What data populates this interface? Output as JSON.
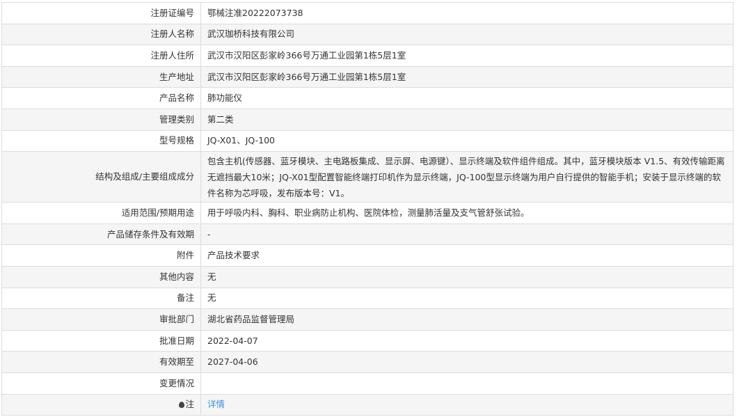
{
  "rows": [
    {
      "label": "注册证编号",
      "value": "鄂械注准20222073738"
    },
    {
      "label": "注册人名称",
      "value": "武汉珈桥科技有限公司"
    },
    {
      "label": "注册人住所",
      "value": "武汉市汉阳区彭家岭366号万通工业园第1栋5层1室"
    },
    {
      "label": "生产地址",
      "value": "武汉市汉阳区彭家岭366号万通工业园第1栋5层1室"
    },
    {
      "label": "产品名称",
      "value": "肺功能仪"
    },
    {
      "label": "管理类别",
      "value": "第二类"
    },
    {
      "label": "型号规格",
      "value": "JQ-X01、JQ-100"
    },
    {
      "label": "结构及组成/主要组成成分",
      "value": "包含主机(传感器、蓝牙模块、主电路板集成、显示屏、电源键）、显示终端及软件组件组成。其中，蓝牙模块版本 V1.5、有效传输距离无遮挡最大10米；JQ-X01型配置智能终端打印机作为显示终端，JQ-100型显示终端为用户自行提供的智能手机；安装于显示终端的软件名称为芯呼吸，发布版本号：V1。"
    },
    {
      "label": "适用范围/预期用途",
      "value": "用于呼吸内科、胸科、职业病防止机构、医院体检，测量肺活量及支气管舒张试验。"
    },
    {
      "label": "产品储存条件及有效期",
      "value": "-"
    },
    {
      "label": "附件",
      "value": "产品技术要求"
    },
    {
      "label": "其他内容",
      "value": "无"
    },
    {
      "label": "备注",
      "value": "无"
    },
    {
      "label": "审批部门",
      "value": "湖北省药品监督管理局"
    },
    {
      "label": "批准日期",
      "value": "2022-04-07"
    },
    {
      "label": "有效期至",
      "value": "2027-04-06"
    },
    {
      "label": "变更情况",
      "value": ""
    }
  ],
  "note": {
    "label": "注",
    "icon": "pin-icon",
    "link": "详情"
  }
}
